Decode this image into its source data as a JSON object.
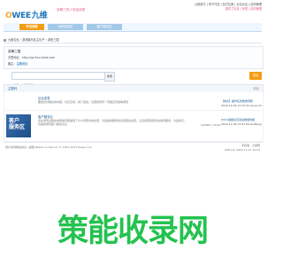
{
  "header": {
    "logo_main": "WEE",
    "logo_o": "O",
    "logo_cn": "九维",
    "tagline": "讲解三张少说话讲那",
    "toplinks_line1": "九维家行 | 申子付送 | 加付注册 | 论坛功名 | 信仰管理",
    "toplinks_line2": "提供了信息 | 标签 | 信仰管理"
  },
  "nav": {
    "tab1": "开设到联",
    "tab2": "玩家游戏区",
    "tab3": "客户服务区"
  },
  "breadcrumb": "九维论坛 › 游戏娱乐区主论子 › 游戏三国",
  "info": {
    "title": "讲解三国",
    "url": "无限地址：http://qz.9vz.hwee.com",
    "admin_label": "版主：",
    "admin_value": "温暖城运"
  },
  "search": {
    "placeholder": "请输入关键字词",
    "button": "搜索",
    "new_post": "发帖"
  },
  "forum": {
    "header": "主题列",
    "collapse": "收起",
    "rows": [
      {
        "icon_text": "",
        "name": "论坛发表",
        "desc": "要发表好相关的内容，论坛互动，热门活动，议题游戏有一同相应问答等游戏",
        "stat": "",
        "last1": "【信息】超时任务数量调整",
        "last2": "2024-12-24 13:10:30 seven-kn"
      },
      {
        "icon_text": "客户\n服务区",
        "name": "客户服务区",
        "desc": "您在游戏过程中或其他问题遇到了什么问题请向这里，为您提供服务建议和更多资源，让您感受到更好的游戏服务，为此我们，也提供游戏部门相关论坛",
        "stat": "1/2000 / 17/10",
        "last1": "tiSO1组相关高奖金数量的相",
        "last2": "2024-11-28 13:41:09 zouBeng"
      }
    ]
  },
  "footer": {
    "left": "用户条例网站协议 | 美国 Based on Discuz! © 2001-2023 Hwee.com",
    "right1": "手机版 · 九维网",
    "right2": "GMT+8, 2024-11-27 16:04"
  },
  "overlay_text": "策能收录网"
}
